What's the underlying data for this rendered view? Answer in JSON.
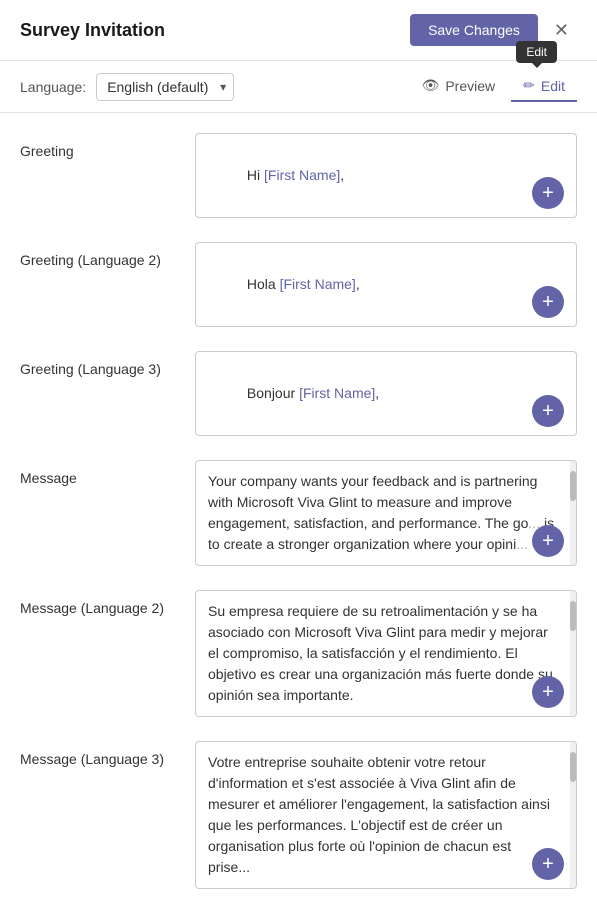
{
  "header": {
    "title": "Survey Invitation",
    "save_button_label": "Save Changes",
    "close_icon": "×"
  },
  "toolbar": {
    "language_label": "Language:",
    "language_value": "English (default)",
    "tabs": [
      {
        "id": "preview",
        "label": "Preview",
        "icon": "👁"
      },
      {
        "id": "edit",
        "label": "Edit",
        "icon": "✏"
      }
    ],
    "active_tab": "edit",
    "tooltip": "Edit"
  },
  "fields": [
    {
      "id": "greeting",
      "label": "Greeting",
      "content_parts": [
        {
          "text": "Hi ",
          "type": "normal"
        },
        {
          "text": "[First Name]",
          "type": "merge"
        },
        {
          "text": ",",
          "type": "normal"
        }
      ],
      "has_scroll": false,
      "type": "short"
    },
    {
      "id": "greeting_lang2",
      "label": "Greeting (Language 2)",
      "content_parts": [
        {
          "text": "Hola ",
          "type": "normal"
        },
        {
          "text": "[First Name]",
          "type": "merge"
        },
        {
          "text": ",",
          "type": "normal"
        }
      ],
      "has_scroll": false,
      "type": "short"
    },
    {
      "id": "greeting_lang3",
      "label": "Greeting (Language 3)",
      "content_parts": [
        {
          "text": "Bonjour ",
          "type": "normal"
        },
        {
          "text": "[First Name]",
          "type": "merge"
        },
        {
          "text": ",",
          "type": "normal"
        }
      ],
      "has_scroll": false,
      "type": "short"
    },
    {
      "id": "message",
      "label": "Message",
      "content_text": "Your company wants your feedback and is partnering with Microsoft Viva Glint to measure and improve engagement, satisfaction, and performance. The go... is to create a stronger organization where your opini... matters.",
      "has_scroll": true,
      "type": "message"
    },
    {
      "id": "message_lang2",
      "label": "Message (Language 2)",
      "content_text": "Su empresa requiere de su retroalimentación y se ha asociado con Microsoft Viva Glint para medir y mejorar el compromiso, la satisfacción y el rendimiento. El objetivo es crear una organización más fuerte donde su opinión sea importante.",
      "has_scroll": true,
      "type": "message"
    },
    {
      "id": "message_lang3",
      "label": "Message (Language 3)",
      "content_text": "Votre entreprise souhaite obtenir votre retour d'information et s'est associée à Viva Glint afin de mesurer et améliorer l'engagement, la satisfaction ainsi que les performances. L'objectif est de créer un organisation plus forte où l'opinion de chacun est prise...",
      "has_scroll": true,
      "type": "message"
    }
  ]
}
